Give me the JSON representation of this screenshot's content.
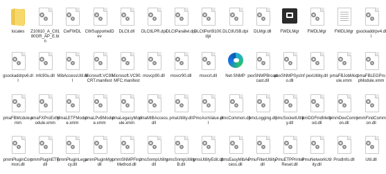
{
  "files": [
    {
      "label": "locales",
      "icon": "folder-icon"
    },
    {
      "label": "Z10810_A_C8180GR_AP_E.bin",
      "icon": "file-icon"
    },
    {
      "label": "CwFWDL",
      "icon": "dll-file-icon"
    },
    {
      "label": "CWSupportedDev",
      "icon": "dll-file-icon"
    },
    {
      "label": "DLCtl.dll",
      "icon": "dll-file-icon"
    },
    {
      "label": "DLCtlLPR.dpi",
      "icon": "dll-file-icon"
    },
    {
      "label": "DLCtParallel.dpi",
      "icon": "dll-file-icon"
    },
    {
      "label": "DLCtlPort9100.dpi",
      "icon": "dll-file-icon"
    },
    {
      "label": "DLCtlUSB.dpi",
      "icon": "dll-file-icon"
    },
    {
      "label": "DLMgr.dll",
      "icon": "dll-file-icon"
    },
    {
      "label": "FWDLMgr",
      "icon": "app-icon"
    },
    {
      "label": "FWDLMgr",
      "icon": "dll-file-icon"
    },
    {
      "label": "FWDLMgr",
      "icon": "document-icon"
    },
    {
      "label": "gsockaddrpv4.dll",
      "icon": "dll-file-icon"
    },
    {
      "label": "gsockaddrpv6.dll",
      "icon": "dll-file-icon"
    },
    {
      "label": "mfc90u.dll",
      "icon": "dll-file-icon"
    },
    {
      "label": "MibAccessUtil.dll",
      "icon": "dll-file-icon"
    },
    {
      "label": "Microsoft.VC90.CRT.manifest",
      "icon": "dll-file-icon"
    },
    {
      "label": "Microsoft.VC90.MFC.manifest",
      "icon": "dll-file-icon"
    },
    {
      "label": "msvcp90.dll",
      "icon": "dll-file-icon"
    },
    {
      "label": "msvcr90.dll",
      "icon": "dll-file-icon"
    },
    {
      "label": "msvcrt.dll",
      "icon": "dll-file-icon"
    },
    {
      "label": "Net-SNMP",
      "icon": "edge-icon"
    },
    {
      "label": "pexSNMPBroadcast.dll",
      "icon": "dll-file-icon"
    },
    {
      "label": "pexSNMPSysInfo.dll",
      "icon": "dll-file-icon"
    },
    {
      "label": "pexUtility.dll",
      "icon": "dll-file-icon"
    },
    {
      "label": "pmaFBJobModule.xmm",
      "icon": "dll-file-icon"
    },
    {
      "label": "pmaFBLEGPropModule.xmm",
      "icon": "dll-file-icon"
    },
    {
      "label": "pmaFBMcdule.xmm",
      "icon": "dll-file-icon"
    },
    {
      "label": "pmaFXProExtModule.xmm",
      "icon": "dll-file-icon"
    },
    {
      "label": "pmaLETFModule.xmm",
      "icon": "dll-file-icon"
    },
    {
      "label": "pmaLPvBModule.xmm",
      "icon": "dll-file-icon"
    },
    {
      "label": "pmaLegacyModule.xmm",
      "icon": "dll-file-icon"
    },
    {
      "label": "pmaMIBAccess.dll",
      "icon": "dll-file-icon"
    },
    {
      "label": "pmaUtility.dll",
      "icon": "dll-file-icon"
    },
    {
      "label": "PmcAsnValue.dll",
      "icon": "dll-file-icon"
    },
    {
      "label": "pmcCommon.dll",
      "icon": "dll-file-icon"
    },
    {
      "label": "pmcLogging.dll",
      "icon": "dll-file-icon"
    },
    {
      "label": "pmcSocketUtility.dll",
      "icon": "dll-file-icon"
    },
    {
      "label": "pmDGFindMethod.dll",
      "icon": "dll-file-icon"
    },
    {
      "label": "pmmDevCommon.dll",
      "icon": "dll-file-icon"
    },
    {
      "label": "pmmFindCommon.dll",
      "icon": "dll-file-icon"
    },
    {
      "label": "pmmPluginCommon.dll",
      "icon": "dll-file-icon"
    },
    {
      "label": "pmmPluginETF.dll",
      "icon": "dll-file-icon"
    },
    {
      "label": "pmmPluginLegacy.dll",
      "icon": "dll-file-icon"
    },
    {
      "label": "pmmPluginMgr.dll",
      "icon": "dll-file-icon"
    },
    {
      "label": "pmmSNMPFindMethod.dll",
      "icon": "dll-file-icon"
    },
    {
      "label": "pmsSnmpUtility.dll",
      "icon": "dll-file-icon"
    },
    {
      "label": "pmsSnmpUtilityB.dll",
      "icon": "dll-file-icon"
    },
    {
      "label": "pmsUtilityEdit.dll",
      "icon": "dll-file-icon"
    },
    {
      "label": "pmsEasyMibAccess.dll",
      "icon": "dll-file-icon"
    },
    {
      "label": "PmuFilterUtility.dll",
      "icon": "dll-file-icon"
    },
    {
      "label": "PmuETPPrinterReset.dll",
      "icon": "dll-file-icon"
    },
    {
      "label": "PmuNetworkUtility.dll",
      "icon": "dll-file-icon"
    },
    {
      "label": "ProdInfo.dll",
      "icon": "dll-file-icon"
    },
    {
      "label": "Util.dll",
      "icon": "dll-file-icon"
    }
  ]
}
